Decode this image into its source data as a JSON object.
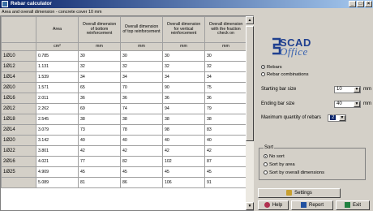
{
  "window": {
    "title": "Rebar calculator",
    "buttons": [
      "_",
      "□",
      "×"
    ]
  },
  "caption": "Area and overall dimension - concrete cover 10 mm",
  "table": {
    "headers": [
      "Area",
      "Overall dimension of bottom reinforcement",
      "Overall dimension of top reinforcement",
      "Overall dimension for vertical reinforcement",
      "Overall dimension with the fraction check on"
    ],
    "units": [
      "cm²",
      "mm",
      "mm",
      "mm",
      "mm"
    ],
    "rows": [
      {
        "label": "1Ø10",
        "cells": [
          "0.785",
          "30",
          "30",
          "30",
          "30"
        ]
      },
      {
        "label": "1Ø12",
        "cells": [
          "1.131",
          "32",
          "32",
          "32",
          "32"
        ]
      },
      {
        "label": "1Ø14",
        "cells": [
          "1.539",
          "34",
          "34",
          "34",
          "34"
        ]
      },
      {
        "label": "2Ø10",
        "cells": [
          "1.571",
          "65",
          "70",
          "90",
          "75"
        ]
      },
      {
        "label": "1Ø16",
        "cells": [
          "2.011",
          "36",
          "36",
          "36",
          "36"
        ]
      },
      {
        "label": "2Ø12",
        "cells": [
          "2.262",
          "69",
          "74",
          "94",
          "79"
        ]
      },
      {
        "label": "1Ø18",
        "cells": [
          "2.545",
          "38",
          "38",
          "38",
          "38"
        ]
      },
      {
        "label": "2Ø14",
        "cells": [
          "3.079",
          "73",
          "78",
          "98",
          "83"
        ]
      },
      {
        "label": "1Ø20",
        "cells": [
          "3.142",
          "40",
          "40",
          "40",
          "40"
        ]
      },
      {
        "label": "1Ø22",
        "cells": [
          "3.801",
          "42",
          "42",
          "42",
          "42"
        ]
      },
      {
        "label": "2Ø16",
        "cells": [
          "4.021",
          "77",
          "82",
          "102",
          "87"
        ]
      },
      {
        "label": "1Ø25",
        "cells": [
          "4.909",
          "45",
          "45",
          "45",
          "45"
        ]
      },
      {
        "label": "",
        "cells": [
          "5.089",
          "81",
          "86",
          "106",
          "91"
        ]
      }
    ]
  },
  "logo": {
    "line1": "SCAD",
    "line2": "Office"
  },
  "mode": {
    "rebars": "Rebars",
    "combinations": "Rebar combinations"
  },
  "fields": {
    "starting_label": "Starting bar size",
    "starting_value": "10",
    "ending_label": "Ending bar size",
    "ending_value": "40",
    "max_label": "Maximum quantity of rebars",
    "max_value": "2",
    "unit": "mm"
  },
  "sort": {
    "legend": "Sort",
    "options": [
      "No sort",
      "Sort by area",
      "Sort by overall dimensions"
    ]
  },
  "buttons": {
    "settings": "Settings",
    "help": "Help",
    "report": "Report",
    "exit": "Exit"
  },
  "icons": [
    "app-icon",
    "settings-icon",
    "help-icon",
    "report-icon",
    "exit-icon"
  ],
  "colors": {
    "title_bar": "#0a246a",
    "logo": "#1f3f8f",
    "selection": "#0a246a"
  }
}
